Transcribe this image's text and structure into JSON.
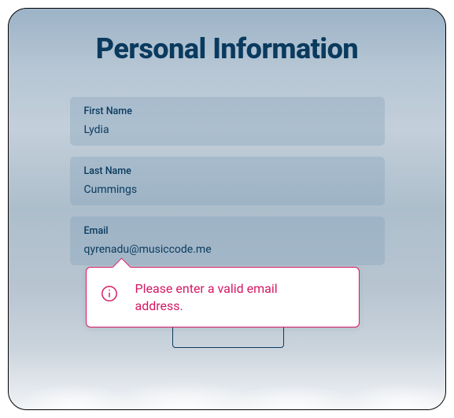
{
  "title": "Personal Information",
  "fields": {
    "firstName": {
      "label": "First Name",
      "value": "Lydia"
    },
    "lastName": {
      "label": "Last Name",
      "value": "Cummings"
    },
    "email": {
      "label": "Email",
      "value": "qyrenadu@musiccode.me"
    }
  },
  "error": {
    "message": "Please enter a valid email address."
  },
  "colors": {
    "accent": "#0a3a5e",
    "error": "#d51963"
  }
}
